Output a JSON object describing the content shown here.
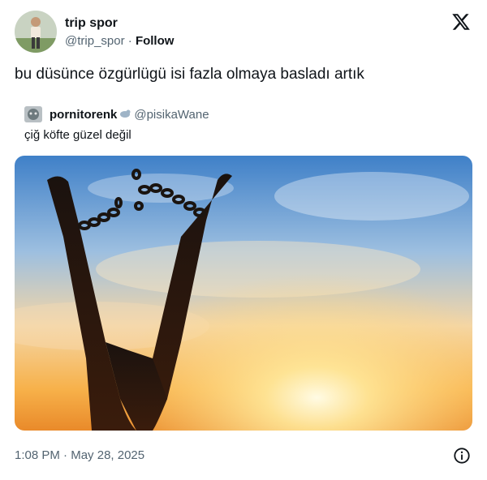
{
  "author": {
    "display_name": "trip spor",
    "handle": "@trip_spor",
    "separator": "·",
    "follow_label": "Follow"
  },
  "tweet": {
    "text": "bu düsünce özgürlügü isi fazla olmaya basladı artık"
  },
  "quoted_tweet": {
    "display_name": "pornitorenk",
    "handle": "@pisikaWane",
    "text": "çiğ köfte güzel değil",
    "emoji": "seal-emoji"
  },
  "media": {
    "kind": "photo",
    "icon": "broken-chains-freedom-photo"
  },
  "footer": {
    "time": "1:08 PM",
    "separator": "·",
    "date": "May 28, 2025"
  },
  "colors": {
    "text_primary": "#0f1419",
    "text_secondary": "#536471",
    "background": "#ffffff"
  },
  "icons": {
    "brand": "x-logo-icon",
    "info": "info-icon"
  }
}
